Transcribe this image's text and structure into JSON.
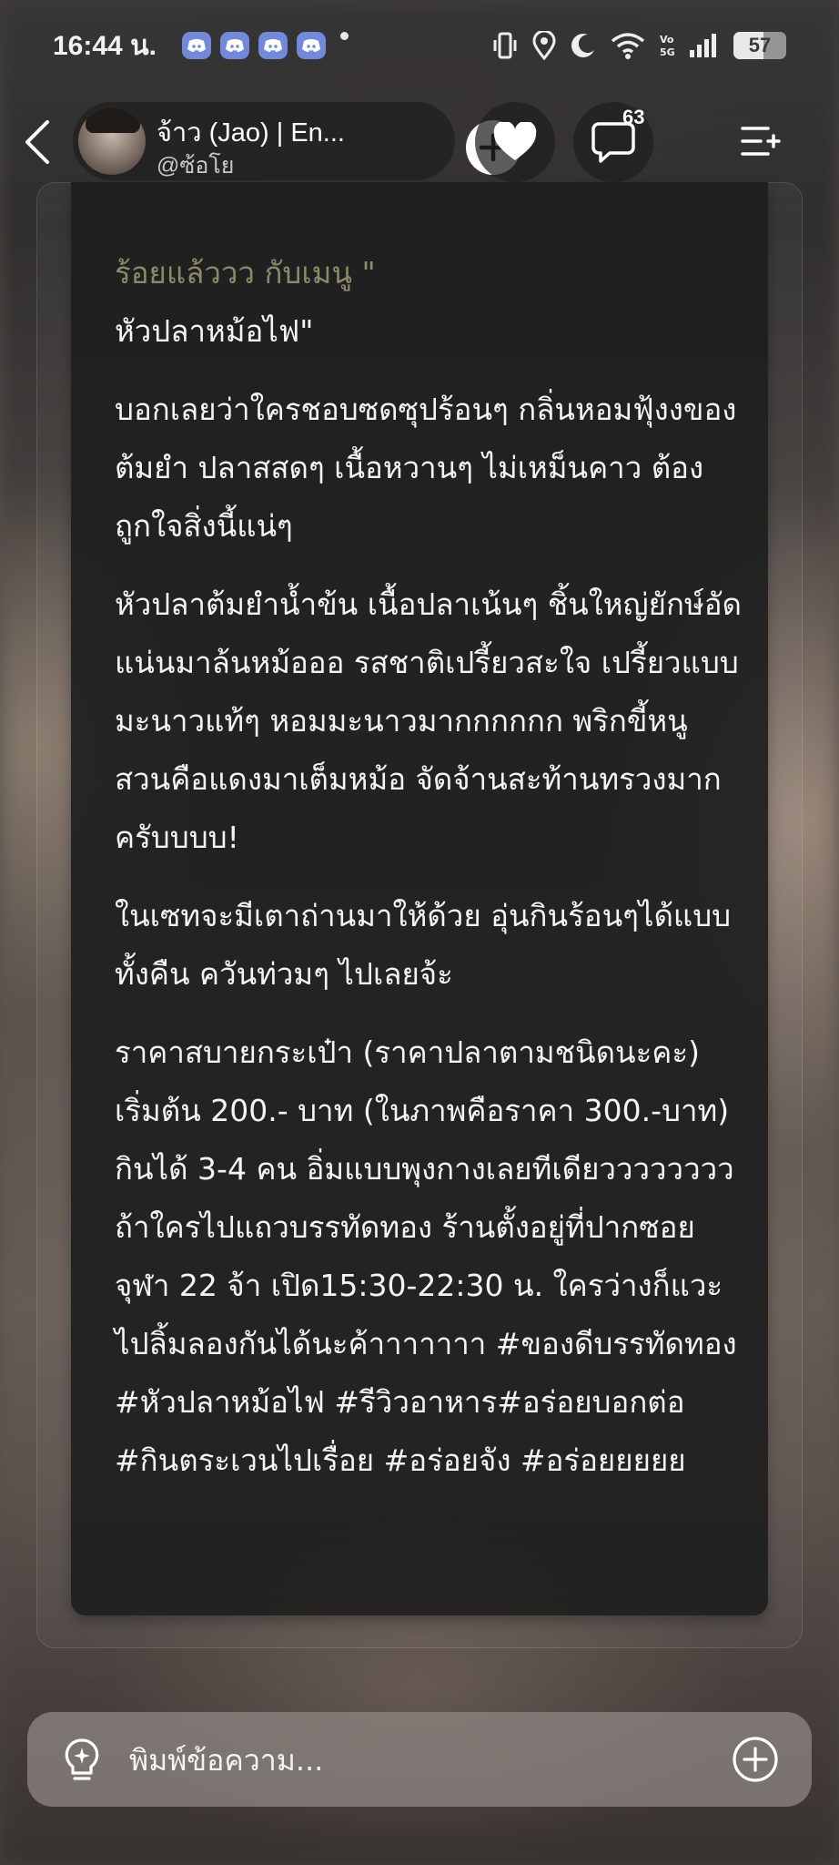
{
  "status_bar": {
    "time": "16:44 น.",
    "battery_level": "57",
    "icons": [
      "discord-icon",
      "discord-icon",
      "discord-icon",
      "discord-icon",
      "dot-icon",
      "vibrate-icon",
      "location-icon",
      "moon-icon",
      "wifi-icon",
      "volte-icon",
      "signal-icon",
      "battery-icon"
    ]
  },
  "header": {
    "profile_name": "จ้าว (Jao) | En...",
    "profile_handle": "@ซ้อโย",
    "comment_count": "63",
    "icons": [
      "back-icon",
      "plus-icon",
      "heart-icon",
      "comment-icon",
      "menu-add-icon"
    ]
  },
  "post": {
    "faded_line": "ร้อยแล้ววว กับเมนู \"",
    "paragraphs": [
      "หัวปลาหม้อไฟ\"",
      "บอกเลยว่าใครชอบซดซุปร้อนๆ กลิ่นหอมฟุ้งงของต้มยำ ปลาสสดๆ เนื้อหวานๆ ไม่เหม็นคาว ต้องถูกใจสิ่งนี้แน่ๆ",
      "หัวปลาต้มยำน้ำข้น เนื้อปลาเน้นๆ ชิ้นใหญ่ยักษ์อัดแน่นมาล้นหม้อออ รสชาติเปรี้ยวสะใจ เปรี้ยวแบบมะนาวแท้ๆ หอมมะนาวมากกกกกก พริกขี้หนูสวนคือแดงมาเต็มหม้อ จัดจ้านสะท้านทรวงมากครับบบบ!",
      "ในเซทจะมีเตาถ่านมาให้ด้วย อุ่นกินร้อนๆได้แบบทั้งคืน ควันท่วมๆ ไปเลยจ้ะ",
      "ราคาสบายกระเป๋า (ราคาปลาตามชนิดนะคะ) เริ่มต้น 200.- บาท (ในภาพคือราคา 300.-บาท) กินได้ 3-4 คน อิ่มแบบพุงกางเลยทีเดียววววววววถ้าใครไปแถวบรรทัดทอง ร้านตั้งอยู่ที่ปากซอยจุฬา 22 จ้า เปิด15:30-22:30 น. ใครว่างก็แวะไปลิ้มลองกันได้นะค้าาาาาาา #ของดีบรรทัดทอง #หัวปลาหม้อไฟ #รีวิวอาหาร#อร่อยบอกต่อ #กินตระเวนไปเรื่อย #อร่อยจัง #อร่อยยยยย"
    ]
  },
  "input": {
    "placeholder": "พิมพ์ข้อความ...",
    "icons": [
      "lightbulb-icon",
      "add-circle-icon"
    ]
  },
  "colors": {
    "card_bg": "#1e1e1e",
    "accent_discord": "#7289da",
    "faded_text": "#8b8b6a",
    "input_bar": "#8c8480"
  }
}
